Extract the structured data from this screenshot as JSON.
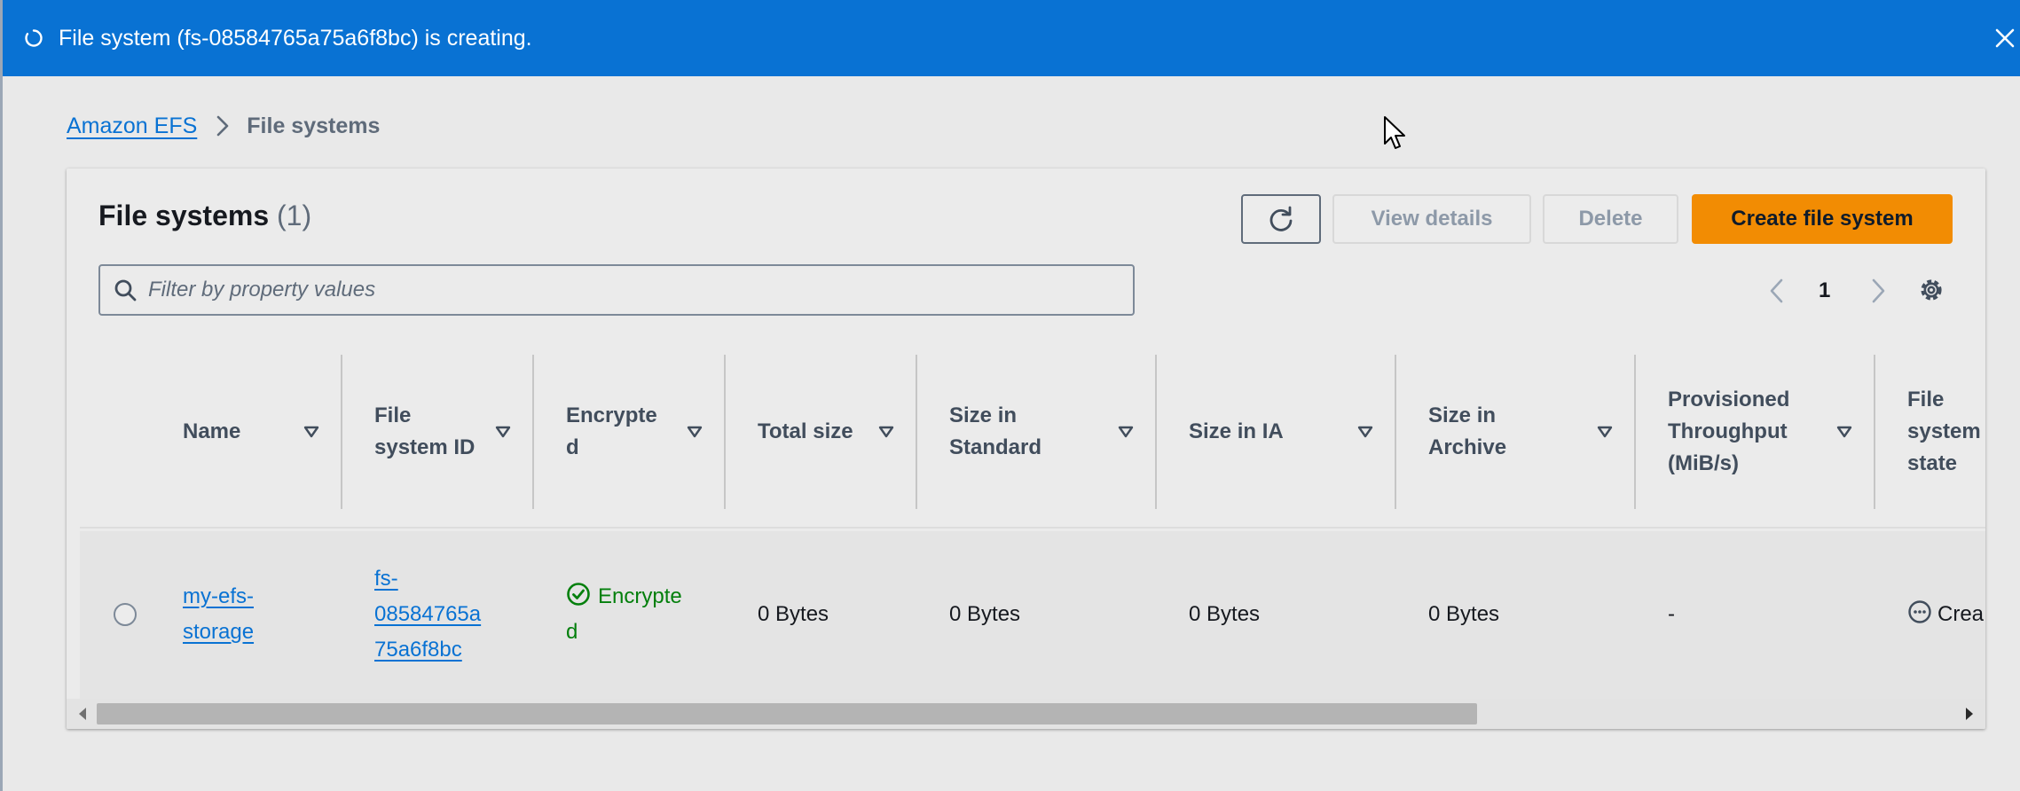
{
  "banner": {
    "message": "File system (fs-08584765a75a6f8bc) is creating.",
    "status": "in-progress",
    "color": "#0972d3"
  },
  "breadcrumb": {
    "items": [
      "Amazon EFS",
      "File systems"
    ]
  },
  "panel": {
    "title": "File systems",
    "count": "(1)"
  },
  "actions": {
    "refresh_icon": "refresh-icon",
    "view_details": "View details",
    "delete": "Delete",
    "create": "Create file system",
    "create_color": "#f28c03"
  },
  "filter": {
    "placeholder": "Filter by property values",
    "value": ""
  },
  "pagination": {
    "current_page": "1"
  },
  "table": {
    "columns": [
      "Name",
      "File system ID",
      "Encrypted",
      "Total size",
      "Size in Standard",
      "Size in IA",
      "Size in Archive",
      "Provisioned Throughput (MiB/s)",
      "File system state"
    ],
    "column_lines": [
      [
        "Name"
      ],
      [
        "File",
        "system ID"
      ],
      [
        "Encrypte",
        "d"
      ],
      [
        "Total size"
      ],
      [
        "Size in",
        "Standard"
      ],
      [
        "Size in IA"
      ],
      [
        "Size in",
        "Archive"
      ],
      [
        "Provisioned",
        "Throughput",
        "(MiB/s)"
      ],
      [
        "File",
        "system",
        "state"
      ]
    ],
    "rows": [
      {
        "selected": false,
        "name_lines": [
          "my-efs-",
          "storage"
        ],
        "id_lines": [
          "fs-",
          "08584765a",
          "75a6f8bc"
        ],
        "encrypted_lines": [
          "Encrypte",
          "d"
        ],
        "total_size": "0 Bytes",
        "size_standard": "0 Bytes",
        "size_ia": "0 Bytes",
        "size_archive": "0 Bytes",
        "provisioned_throughput": "-",
        "state": "Crea"
      }
    ]
  }
}
